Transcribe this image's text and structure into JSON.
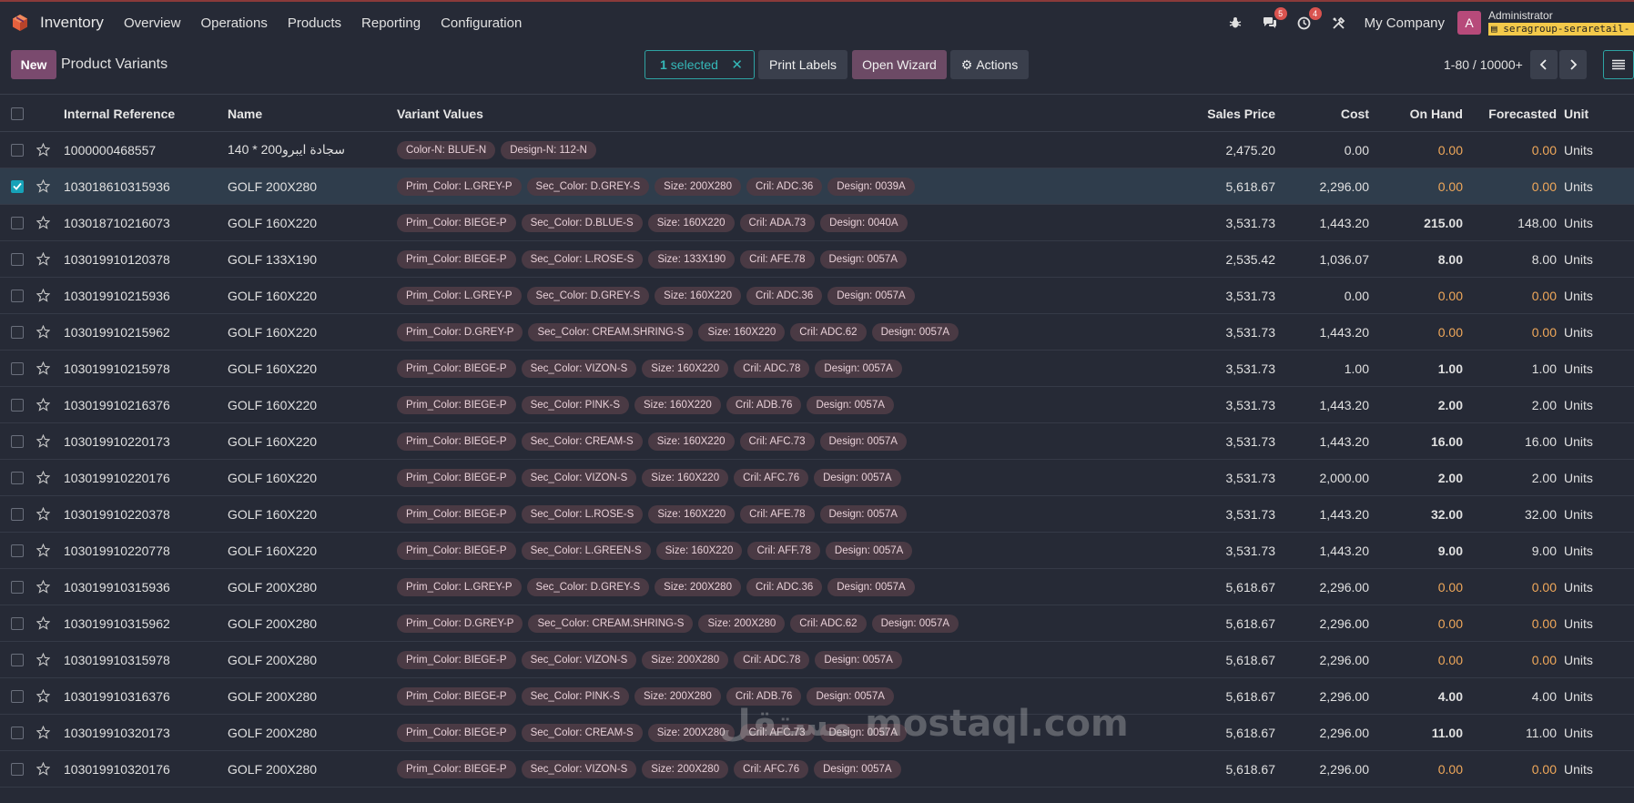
{
  "navbar": {
    "app_name": "Inventory",
    "menu": [
      "Overview",
      "Operations",
      "Products",
      "Reporting",
      "Configuration"
    ],
    "messages_badge": "5",
    "activity_badge": "4",
    "company": "My Company",
    "avatar_letter": "A",
    "user_name": "Administrator",
    "database": "seragroup-seraretail-"
  },
  "control": {
    "new_label": "New",
    "breadcrumb": "Product Variants",
    "selected_count": "1",
    "selected_label": "selected",
    "print_labels": "Print Labels",
    "open_wizard": "Open Wizard",
    "actions": "Actions",
    "pager": "1-80 / 10000+"
  },
  "columns": {
    "ref": "Internal Reference",
    "name": "Name",
    "variant": "Variant Values",
    "sales": "Sales Price",
    "cost": "Cost",
    "onhand": "On Hand",
    "forecast": "Forecasted",
    "unit": "Unit"
  },
  "rows": [
    {
      "ref": "1000000468557",
      "name": "سجادة ايبرو200 * 140",
      "tags": [
        "Color-N: BLUE-N",
        "Design-N: 112-N"
      ],
      "sales": "2,475.20",
      "cost": "0.00",
      "onhand": "0.00",
      "forecast": "0.00",
      "unit": "Units",
      "selected": false
    },
    {
      "ref": "103018610315936",
      "name": "GOLF 200X280",
      "tags": [
        "Prim_Color: L.GREY-P",
        "Sec_Color: D.GREY-S",
        "Size: 200X280",
        "Cril: ADC.36",
        "Design: 0039A"
      ],
      "sales": "5,618.67",
      "cost": "2,296.00",
      "onhand": "0.00",
      "forecast": "0.00",
      "unit": "Units",
      "selected": true
    },
    {
      "ref": "103018710216073",
      "name": "GOLF 160X220",
      "tags": [
        "Prim_Color: BIEGE-P",
        "Sec_Color: D.BLUE-S",
        "Size: 160X220",
        "Cril: ADA.73",
        "Design: 0040A"
      ],
      "sales": "3,531.73",
      "cost": "1,443.20",
      "onhand": "215.00",
      "forecast": "148.00",
      "unit": "Units",
      "selected": false
    },
    {
      "ref": "103019910120378",
      "name": "GOLF 133X190",
      "tags": [
        "Prim_Color: BIEGE-P",
        "Sec_Color: L.ROSE-S",
        "Size: 133X190",
        "Cril: AFE.78",
        "Design: 0057A"
      ],
      "sales": "2,535.42",
      "cost": "1,036.07",
      "onhand": "8.00",
      "forecast": "8.00",
      "unit": "Units",
      "selected": false
    },
    {
      "ref": "103019910215936",
      "name": "GOLF 160X220",
      "tags": [
        "Prim_Color: L.GREY-P",
        "Sec_Color: D.GREY-S",
        "Size: 160X220",
        "Cril: ADC.36",
        "Design: 0057A"
      ],
      "sales": "3,531.73",
      "cost": "0.00",
      "onhand": "0.00",
      "forecast": "0.00",
      "unit": "Units",
      "selected": false
    },
    {
      "ref": "103019910215962",
      "name": "GOLF 160X220",
      "tags": [
        "Prim_Color: D.GREY-P",
        "Sec_Color: CREAM.SHRING-S",
        "Size: 160X220",
        "Cril: ADC.62",
        "Design: 0057A"
      ],
      "sales": "3,531.73",
      "cost": "1,443.20",
      "onhand": "0.00",
      "forecast": "0.00",
      "unit": "Units",
      "selected": false
    },
    {
      "ref": "103019910215978",
      "name": "GOLF 160X220",
      "tags": [
        "Prim_Color: BIEGE-P",
        "Sec_Color: VIZON-S",
        "Size: 160X220",
        "Cril: ADC.78",
        "Design: 0057A"
      ],
      "sales": "3,531.73",
      "cost": "1.00",
      "onhand": "1.00",
      "forecast": "1.00",
      "unit": "Units",
      "selected": false
    },
    {
      "ref": "103019910216376",
      "name": "GOLF 160X220",
      "tags": [
        "Prim_Color: BIEGE-P",
        "Sec_Color: PINK-S",
        "Size: 160X220",
        "Cril: ADB.76",
        "Design: 0057A"
      ],
      "sales": "3,531.73",
      "cost": "1,443.20",
      "onhand": "2.00",
      "forecast": "2.00",
      "unit": "Units",
      "selected": false
    },
    {
      "ref": "103019910220173",
      "name": "GOLF 160X220",
      "tags": [
        "Prim_Color: BIEGE-P",
        "Sec_Color: CREAM-S",
        "Size: 160X220",
        "Cril: AFC.73",
        "Design: 0057A"
      ],
      "sales": "3,531.73",
      "cost": "1,443.20",
      "onhand": "16.00",
      "forecast": "16.00",
      "unit": "Units",
      "selected": false
    },
    {
      "ref": "103019910220176",
      "name": "GOLF 160X220",
      "tags": [
        "Prim_Color: BIEGE-P",
        "Sec_Color: VIZON-S",
        "Size: 160X220",
        "Cril: AFC.76",
        "Design: 0057A"
      ],
      "sales": "3,531.73",
      "cost": "2,000.00",
      "onhand": "2.00",
      "forecast": "2.00",
      "unit": "Units",
      "selected": false
    },
    {
      "ref": "103019910220378",
      "name": "GOLF 160X220",
      "tags": [
        "Prim_Color: BIEGE-P",
        "Sec_Color: L.ROSE-S",
        "Size: 160X220",
        "Cril: AFE.78",
        "Design: 0057A"
      ],
      "sales": "3,531.73",
      "cost": "1,443.20",
      "onhand": "32.00",
      "forecast": "32.00",
      "unit": "Units",
      "selected": false
    },
    {
      "ref": "103019910220778",
      "name": "GOLF 160X220",
      "tags": [
        "Prim_Color: BIEGE-P",
        "Sec_Color: L.GREEN-S",
        "Size: 160X220",
        "Cril: AFF.78",
        "Design: 0057A"
      ],
      "sales": "3,531.73",
      "cost": "1,443.20",
      "onhand": "9.00",
      "forecast": "9.00",
      "unit": "Units",
      "selected": false
    },
    {
      "ref": "103019910315936",
      "name": "GOLF 200X280",
      "tags": [
        "Prim_Color: L.GREY-P",
        "Sec_Color: D.GREY-S",
        "Size: 200X280",
        "Cril: ADC.36",
        "Design: 0057A"
      ],
      "sales": "5,618.67",
      "cost": "2,296.00",
      "onhand": "0.00",
      "forecast": "0.00",
      "unit": "Units",
      "selected": false
    },
    {
      "ref": "103019910315962",
      "name": "GOLF 200X280",
      "tags": [
        "Prim_Color: D.GREY-P",
        "Sec_Color: CREAM.SHRING-S",
        "Size: 200X280",
        "Cril: ADC.62",
        "Design: 0057A"
      ],
      "sales": "5,618.67",
      "cost": "2,296.00",
      "onhand": "0.00",
      "forecast": "0.00",
      "unit": "Units",
      "selected": false
    },
    {
      "ref": "103019910315978",
      "name": "GOLF 200X280",
      "tags": [
        "Prim_Color: BIEGE-P",
        "Sec_Color: VIZON-S",
        "Size: 200X280",
        "Cril: ADC.78",
        "Design: 0057A"
      ],
      "sales": "5,618.67",
      "cost": "2,296.00",
      "onhand": "0.00",
      "forecast": "0.00",
      "unit": "Units",
      "selected": false
    },
    {
      "ref": "103019910316376",
      "name": "GOLF 200X280",
      "tags": [
        "Prim_Color: BIEGE-P",
        "Sec_Color: PINK-S",
        "Size: 200X280",
        "Cril: ADB.76",
        "Design: 0057A"
      ],
      "sales": "5,618.67",
      "cost": "2,296.00",
      "onhand": "4.00",
      "forecast": "4.00",
      "unit": "Units",
      "selected": false
    },
    {
      "ref": "103019910320173",
      "name": "GOLF 200X280",
      "tags": [
        "Prim_Color: BIEGE-P",
        "Sec_Color: CREAM-S",
        "Size: 200X280",
        "Cril: AFC.73",
        "Design: 0057A"
      ],
      "sales": "5,618.67",
      "cost": "2,296.00",
      "onhand": "11.00",
      "forecast": "11.00",
      "unit": "Units",
      "selected": false
    },
    {
      "ref": "103019910320176",
      "name": "GOLF 200X280",
      "tags": [
        "Prim_Color: BIEGE-P",
        "Sec_Color: VIZON-S",
        "Size: 200X280",
        "Cril: AFC.76",
        "Design: 0057A"
      ],
      "sales": "5,618.67",
      "cost": "2,296.00",
      "onhand": "0.00",
      "forecast": "0.00",
      "unit": "Units",
      "selected": false
    }
  ],
  "watermark": "مستقل mostaql.com",
  "colors": {
    "background": "#262a36",
    "accent_teal": "#2ea3a3",
    "primary_button": "#7a4a6e",
    "zero_value": "#f0a85a",
    "tag_bg": "#4a3a44"
  }
}
